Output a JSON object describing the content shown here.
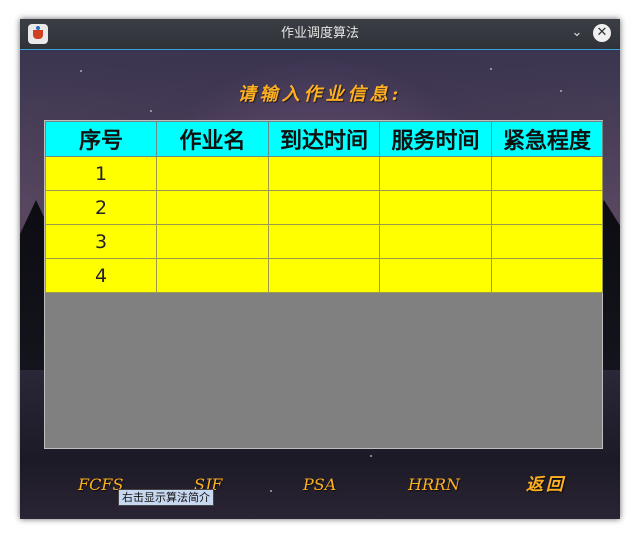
{
  "window": {
    "title": "作业调度算法",
    "icons": {
      "app": "java-cup-icon",
      "minimize": "chevron-down-icon",
      "close": "close-icon"
    }
  },
  "heading": "请输入作业信息:",
  "table": {
    "columns": [
      "序号",
      "作业名",
      "到达时间",
      "服务时间",
      "紧急程度"
    ],
    "rows": [
      [
        "1",
        "",
        "",
        "",
        ""
      ],
      [
        "2",
        "",
        "",
        "",
        ""
      ],
      [
        "3",
        "",
        "",
        "",
        ""
      ],
      [
        "4",
        "",
        "",
        "",
        ""
      ]
    ]
  },
  "buttons": {
    "fcfs": "FCFS",
    "sjf": "SJF",
    "psa": "PSA",
    "hrrn": "HRRN",
    "back": "返回"
  },
  "tooltip": "右击显示算法简介",
  "colors": {
    "header_bg": "#00ffff",
    "cell_bg": "#ffff00",
    "empty_area": "#808080",
    "accent_text": "#ffb020"
  }
}
